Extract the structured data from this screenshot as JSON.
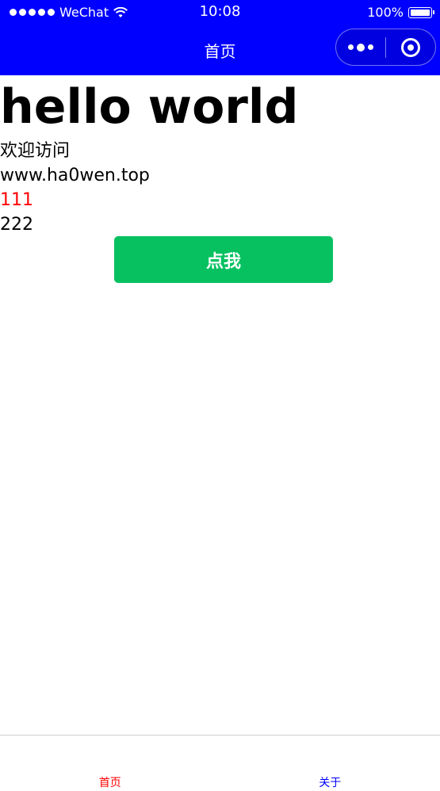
{
  "status_bar": {
    "carrier": "WeChat",
    "time": "10:08",
    "battery": "100%"
  },
  "nav": {
    "title": "首页"
  },
  "content": {
    "headline": "hello world",
    "lines": [
      "欢迎访问",
      "www.ha0wen.top",
      "111",
      "222"
    ],
    "button_label": "点我"
  },
  "tabs": [
    {
      "label": "首页",
      "color": "#ff0000"
    },
    {
      "label": "关于",
      "color": "#0000ff"
    }
  ],
  "colors": {
    "header_bg": "#0000ff",
    "button_bg": "#07c160",
    "red_text": "#ff0000"
  },
  "icons": [
    "signal-dots-icon",
    "wifi-icon",
    "battery-icon",
    "more-dots-icon",
    "target-icon"
  ]
}
